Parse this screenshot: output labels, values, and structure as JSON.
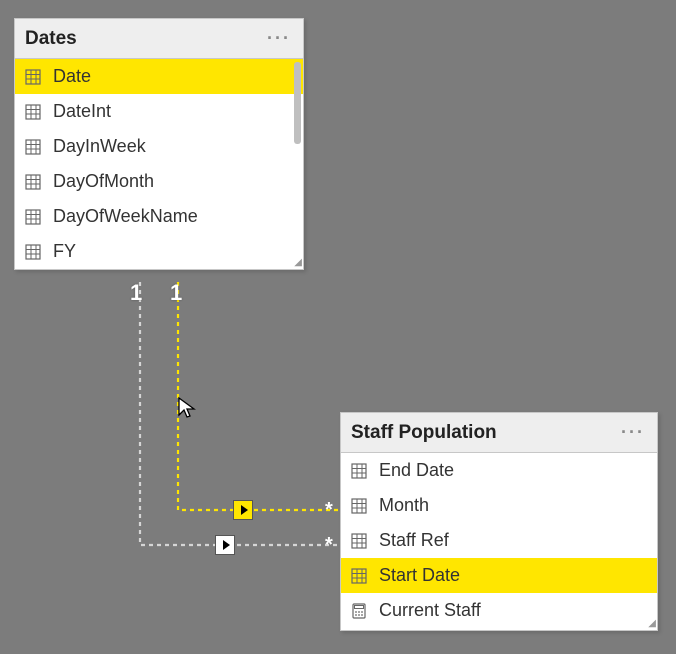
{
  "dates_table": {
    "title": "Dates",
    "fields": [
      {
        "label": "Date",
        "icon": "column",
        "selected": true
      },
      {
        "label": "DateInt",
        "icon": "column",
        "selected": false
      },
      {
        "label": "DayInWeek",
        "icon": "column",
        "selected": false
      },
      {
        "label": "DayOfMonth",
        "icon": "column",
        "selected": false
      },
      {
        "label": "DayOfWeekName",
        "icon": "column",
        "selected": false
      },
      {
        "label": "FY",
        "icon": "column",
        "selected": false
      }
    ]
  },
  "staff_table": {
    "title": "Staff Population",
    "fields": [
      {
        "label": "End Date",
        "icon": "column",
        "selected": false
      },
      {
        "label": "Month",
        "icon": "column",
        "selected": false
      },
      {
        "label": "Staff Ref",
        "icon": "column",
        "selected": false
      },
      {
        "label": "Start Date",
        "icon": "column",
        "selected": true
      },
      {
        "label": "Current Staff",
        "icon": "measure",
        "selected": false
      }
    ]
  },
  "rel": {
    "left_card": "1",
    "right_card": "1",
    "star1": "*",
    "star2": "*"
  },
  "colors": {
    "highlight": "#ffe600",
    "bg": "#7c7c7c"
  }
}
